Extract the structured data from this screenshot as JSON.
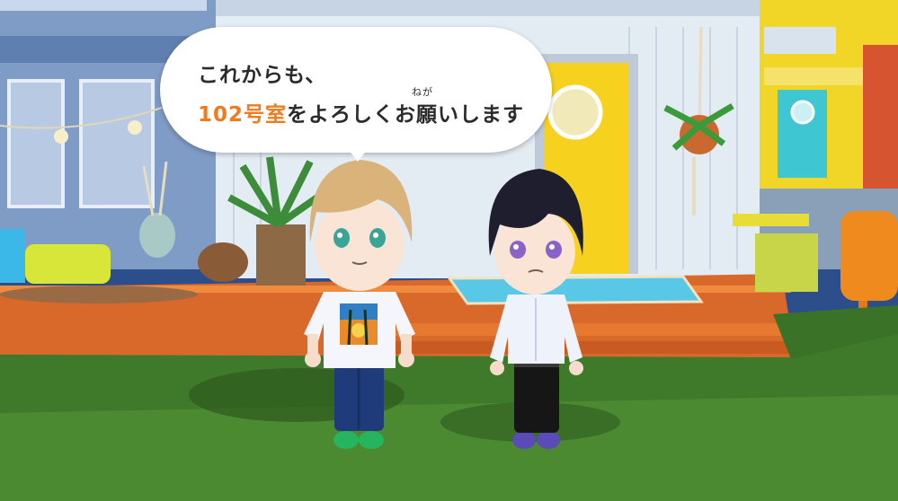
{
  "dialogue": {
    "line1": "これからも、",
    "line2_highlight": "102号室",
    "line2_rest": "をよろしくお願いします",
    "ruby": "ねが"
  },
  "colors": {
    "highlight": "#f07a1c",
    "text": "#2b2b2b",
    "bubble": "#ffffff",
    "grass": "#3f7a2a",
    "deck": "#d9692a",
    "house_wall": "#e3ebf3",
    "door_yellow": "#f6d21f",
    "door_teal": "#3fc6d3"
  },
  "characters": [
    {
      "name_icon": "blond-avatar",
      "shirt": "palm-tree-tshirt",
      "pants": "navy-jeans",
      "shoes": "green-sneakers"
    },
    {
      "name_icon": "dark-haired-avatar",
      "shirt": "white-button-shirt",
      "pants": "black-slacks",
      "shoes": "purple-sneakers"
    }
  ]
}
